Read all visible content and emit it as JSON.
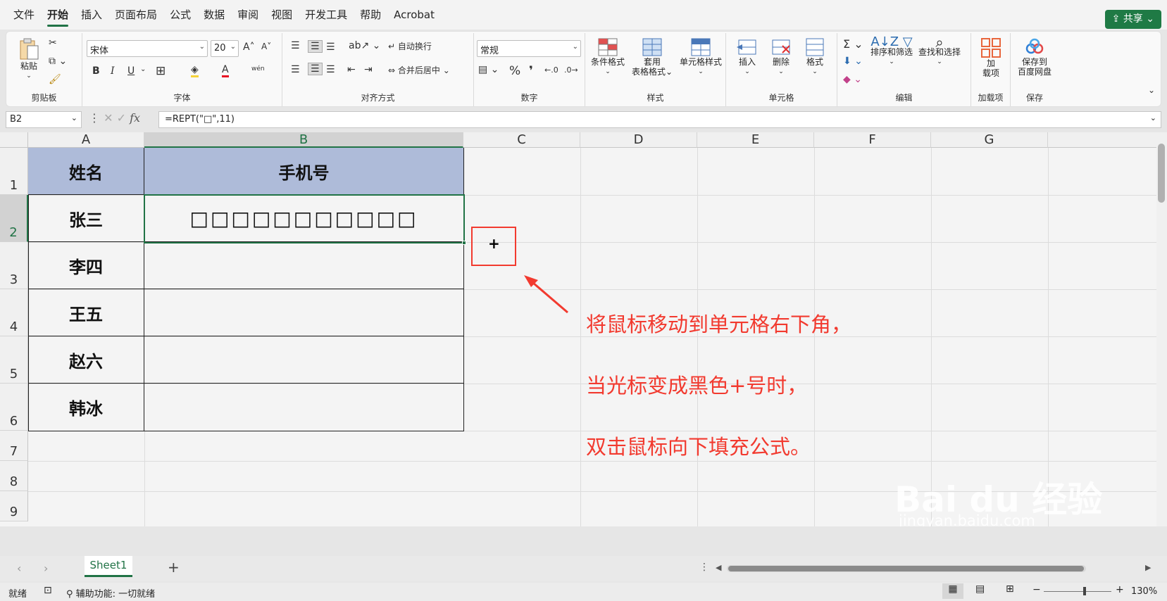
{
  "menu": {
    "items": [
      "文件",
      "开始",
      "插入",
      "页面布局",
      "公式",
      "数据",
      "审阅",
      "视图",
      "开发工具",
      "帮助",
      "Acrobat"
    ],
    "active": "开始",
    "share_label": "共享"
  },
  "ribbon": {
    "clipboard": {
      "paste": "粘贴",
      "label": "剪贴板"
    },
    "font": {
      "name": "宋体",
      "size": "20",
      "label": "字体",
      "bold": "B",
      "italic": "I",
      "underline": "U"
    },
    "alignment": {
      "wrap": "自动换行",
      "merge": "合并后居中",
      "label": "对齐方式"
    },
    "number": {
      "format": "常规",
      "percent": "%",
      "comma": "❜",
      "label": "数字"
    },
    "styles": {
      "conditional": "条件格式",
      "table_format_1": "套用",
      "table_format_2": "表格格式",
      "cell_styles": "单元格样式",
      "label": "样式"
    },
    "cells": {
      "insert": "插入",
      "delete": "删除",
      "format": "格式",
      "label": "单元格"
    },
    "editing": {
      "sort_filter": "排序和筛选",
      "find_select": "查找和选择",
      "label": "编辑"
    },
    "addins": {
      "addins_1": "加",
      "addins_2": "载项",
      "label": "加载项"
    },
    "save": {
      "save_1": "保存到",
      "save_2": "百度网盘",
      "label": "保存"
    }
  },
  "formula_bar": {
    "name_box": "B2",
    "fx": "fx",
    "formula": "=REPT(\"□\",11)"
  },
  "columns": [
    "A",
    "B",
    "C",
    "D",
    "E",
    "F",
    "G"
  ],
  "active_column": "B",
  "rows": [
    "1",
    "2",
    "3",
    "4",
    "5",
    "6",
    "7",
    "8",
    "9"
  ],
  "active_row": "2",
  "table": {
    "header_name": "姓名",
    "header_phone": "手机号",
    "names": [
      "张三",
      "李四",
      "王五",
      "赵六",
      "韩冰"
    ],
    "b2_value": "□□□□□□□□□□□"
  },
  "colors": {
    "header_fill": "#aebbd9",
    "accent_green": "#217346",
    "annotation_red": "#f23a2f"
  },
  "annotation": {
    "cursor_symbol": "+",
    "lines": [
      "将鼠标移动到单元格右下角，",
      "当光标变成黑色+号时，",
      "双击鼠标向下填充公式。"
    ]
  },
  "watermark": {
    "brand": "Bai du 经验",
    "url": "jingyan.baidu.com"
  },
  "sheets": {
    "tabs": [
      "Sheet1"
    ],
    "active": "Sheet1",
    "add": "+"
  },
  "status": {
    "ready": "就绪",
    "accessibility": "辅助功能: 一切就绪",
    "zoom": "130%"
  }
}
